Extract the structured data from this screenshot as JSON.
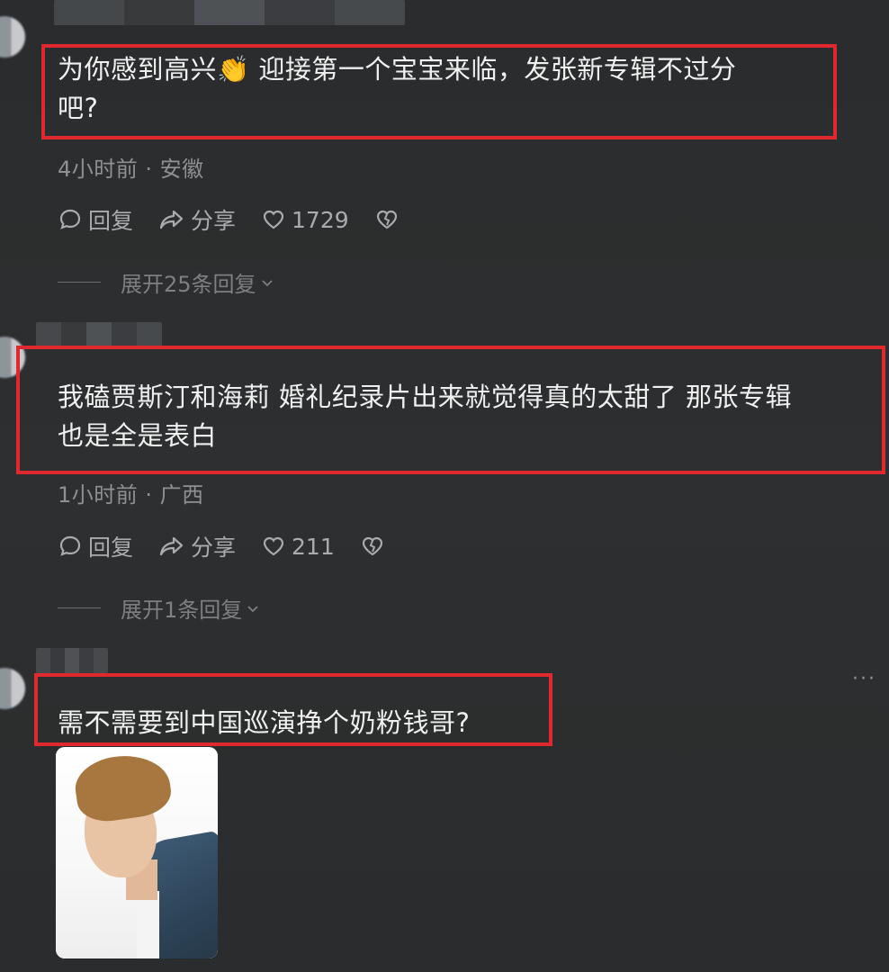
{
  "comments": [
    {
      "text_line1": "为你感到高兴👏  迎接第一个宝宝来临，发张新专辑不过分",
      "text_line2": "吧?",
      "time_location": "4小时前 · 安徽",
      "reply_label": "回复",
      "share_label": "分享",
      "like_count": "1729",
      "expand_label": "展开25条回复"
    },
    {
      "text_line1": "我磕贾斯汀和海莉 婚礼纪录片出来就觉得真的太甜了 那张专辑",
      "text_line2": "也是全是表白",
      "time_location": "1小时前 · 广西",
      "reply_label": "回复",
      "share_label": "分享",
      "like_count": "211",
      "expand_label": "展开1条回复"
    },
    {
      "text_line1": "需不需要到中国巡演挣个奶粉钱哥?",
      "more_label": "···"
    }
  ],
  "colors": {
    "background": "#2b2d2e",
    "highlight_border": "#e0282f",
    "text_primary": "#f0f0f0",
    "text_meta": "#8e9194"
  },
  "icons": {
    "reply": "comment-bubble-icon",
    "share": "share-arrow-icon",
    "like": "heart-icon",
    "dislike": "broken-heart-icon",
    "expand": "chevron-down-icon",
    "more": "more-dots-icon"
  }
}
